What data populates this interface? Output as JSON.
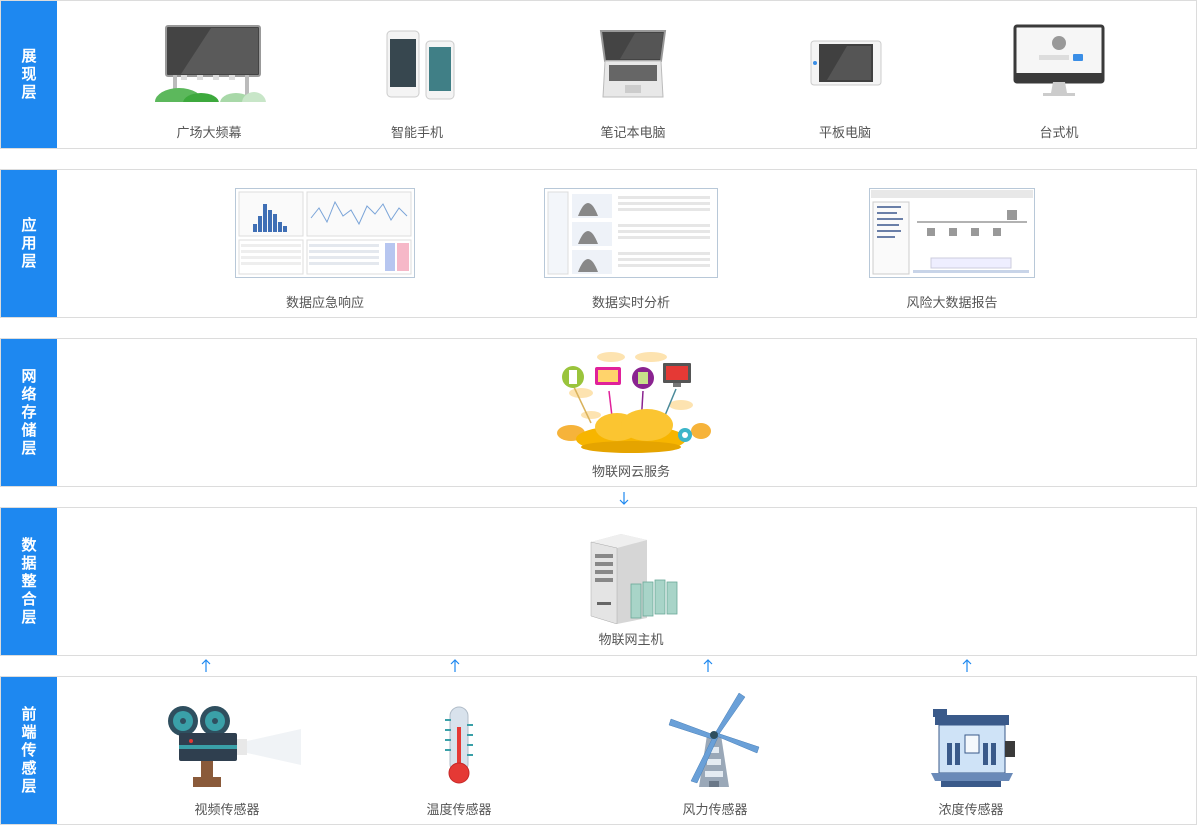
{
  "colors": {
    "accent": "#1e88f0",
    "border": "#dcdcdc",
    "caption": "#555555"
  },
  "layers": {
    "display": {
      "label": "展现层",
      "items": [
        {
          "caption": "广场大频幕",
          "icon": "billboard-icon"
        },
        {
          "caption": "智能手机",
          "icon": "smartphone-icon"
        },
        {
          "caption": "笔记本电脑",
          "icon": "laptop-icon"
        },
        {
          "caption": "平板电脑",
          "icon": "tablet-icon"
        },
        {
          "caption": "台式机",
          "icon": "desktop-icon"
        }
      ]
    },
    "application": {
      "label": "应用层",
      "items": [
        {
          "caption": "数据应急响应",
          "icon": "dashboard-screenshot-icon"
        },
        {
          "caption": "数据实时分析",
          "icon": "analysis-screenshot-icon"
        },
        {
          "caption": "风险大数据报告",
          "icon": "report-screenshot-icon"
        }
      ]
    },
    "network": {
      "label": "网络存储层",
      "items": [
        {
          "caption": "物联网云服务",
          "icon": "cloud-service-icon"
        }
      ]
    },
    "integration": {
      "label": "数据整合层",
      "items": [
        {
          "caption": "物联网主机",
          "icon": "server-icon"
        }
      ]
    },
    "sensor": {
      "label": "前端传感层",
      "items": [
        {
          "caption": "视频传感器",
          "icon": "video-camera-icon"
        },
        {
          "caption": "温度传感器",
          "icon": "thermometer-icon"
        },
        {
          "caption": "风力传感器",
          "icon": "windmill-icon"
        },
        {
          "caption": "浓度传感器",
          "icon": "concentration-machine-icon"
        }
      ]
    }
  }
}
